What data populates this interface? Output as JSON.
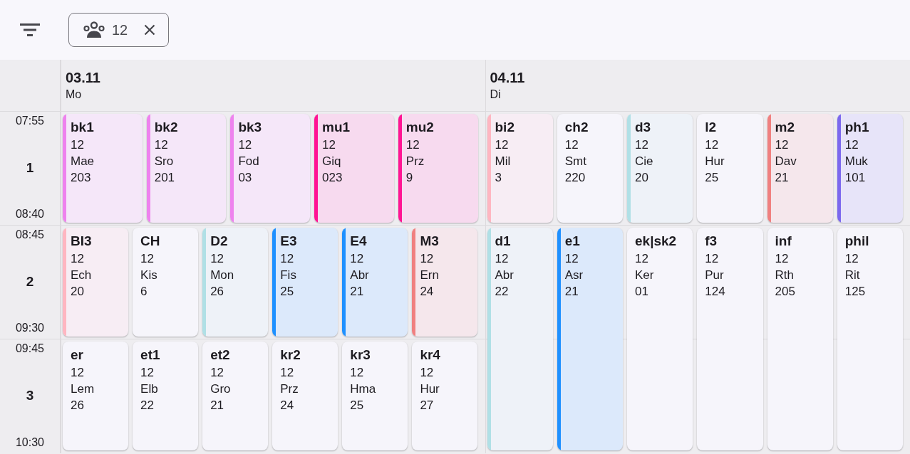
{
  "toolbar": {
    "chip": {
      "label": "12"
    }
  },
  "periods": [
    {
      "number": "1",
      "start": "07:55",
      "end": "08:40"
    },
    {
      "number": "2",
      "start": "08:45",
      "end": "09:30"
    },
    {
      "number": "3",
      "start": "09:45",
      "end": "10:30"
    }
  ],
  "days": [
    {
      "date": "03.11",
      "weekday": "Mo",
      "blocks": [
        {
          "kind": "single",
          "lessons": [
            {
              "subject": "bk1",
              "class": "12",
              "teacher": "Mae",
              "room": "203",
              "color": "#ee82ee"
            },
            {
              "subject": "bk2",
              "class": "12",
              "teacher": "Sro",
              "room": "201",
              "color": "#ee82ee"
            },
            {
              "subject": "bk3",
              "class": "12",
              "teacher": "Fod",
              "room": "03",
              "color": "#ee82ee"
            },
            {
              "subject": "mu1",
              "class": "12",
              "teacher": "Giq",
              "room": "023",
              "color": "#ff1493"
            },
            {
              "subject": "mu2",
              "class": "12",
              "teacher": "Prz",
              "room": "9",
              "color": "#ff1493"
            }
          ]
        },
        {
          "kind": "single",
          "lessons": [
            {
              "subject": "BI3",
              "class": "12",
              "teacher": "Ech",
              "room": "20",
              "color": "#ffb6c1"
            },
            {
              "subject": "CH",
              "class": "12",
              "teacher": "Kis",
              "room": "6"
            },
            {
              "subject": "D2",
              "class": "12",
              "teacher": "Mon",
              "room": "26",
              "color": "#b0e0e6"
            },
            {
              "subject": "E3",
              "class": "12",
              "teacher": "Fis",
              "room": "25",
              "color": "#1e90ff"
            },
            {
              "subject": "E4",
              "class": "12",
              "teacher": "Abr",
              "room": "21",
              "color": "#1e90ff"
            },
            {
              "subject": "M3",
              "class": "12",
              "teacher": "Ern",
              "room": "24",
              "color": "#f08080"
            }
          ]
        },
        {
          "kind": "single",
          "lessons": [
            {
              "subject": "er",
              "class": "12",
              "teacher": "Lem",
              "room": "26"
            },
            {
              "subject": "et1",
              "class": "12",
              "teacher": "Elb",
              "room": "22"
            },
            {
              "subject": "et2",
              "class": "12",
              "teacher": "Gro",
              "room": "21"
            },
            {
              "subject": "kr2",
              "class": "12",
              "teacher": "Prz",
              "room": "24"
            },
            {
              "subject": "kr3",
              "class": "12",
              "teacher": "Hma",
              "room": "25"
            },
            {
              "subject": "kr4",
              "class": "12",
              "teacher": "Hur",
              "room": "27"
            }
          ]
        }
      ]
    },
    {
      "date": "04.11",
      "weekday": "Di",
      "blocks": [
        {
          "kind": "single",
          "lessons": [
            {
              "subject": "bi2",
              "class": "12",
              "teacher": "Mil",
              "room": "3",
              "color": "#ffb6c1"
            },
            {
              "subject": "ch2",
              "class": "12",
              "teacher": "Smt",
              "room": "220"
            },
            {
              "subject": "d3",
              "class": "12",
              "teacher": "Cie",
              "room": "20",
              "color": "#b0e0e6"
            },
            {
              "subject": "l2",
              "class": "12",
              "teacher": "Hur",
              "room": "25"
            },
            {
              "subject": "m2",
              "class": "12",
              "teacher": "Dav",
              "room": "21",
              "color": "#f08080"
            },
            {
              "subject": "ph1",
              "class": "12",
              "teacher": "Muk",
              "room": "101",
              "color": "#7b68ee"
            }
          ]
        },
        {
          "kind": "double",
          "lessons": [
            {
              "subject": "d1",
              "class": "12",
              "teacher": "Abr",
              "room": "22",
              "color": "#b0e0e6"
            },
            {
              "subject": "e1",
              "class": "12",
              "teacher": "Asr",
              "room": "21",
              "color": "#1e90ff"
            },
            {
              "subject": "ek|sk2",
              "class": "12",
              "teacher": "Ker",
              "room": "01"
            },
            {
              "subject": "f3",
              "class": "12",
              "teacher": "Pur",
              "room": "124"
            },
            {
              "subject": "inf",
              "class": "12",
              "teacher": "Rth",
              "room": "205"
            },
            {
              "subject": "phil",
              "class": "12",
              "teacher": "Rit",
              "room": "125"
            }
          ]
        }
      ]
    }
  ]
}
